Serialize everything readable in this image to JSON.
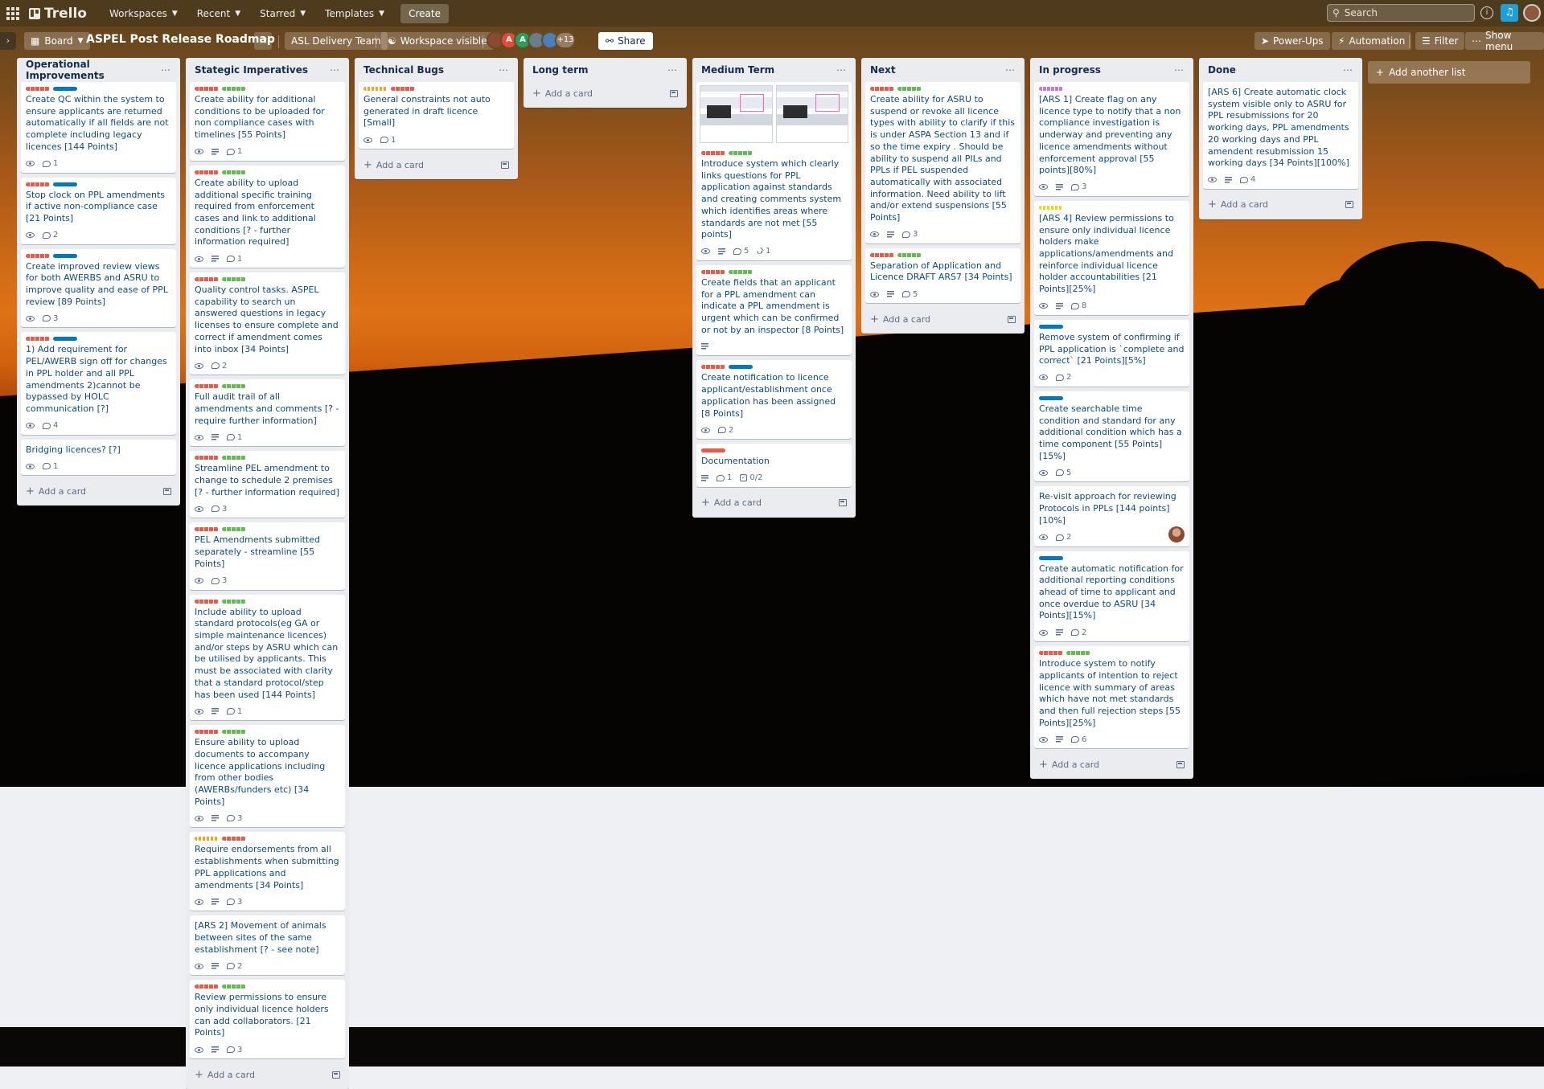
{
  "header": {
    "app_name": "Trello",
    "nav": [
      "Workspaces",
      "Recent",
      "Starred",
      "Templates"
    ],
    "create": "Create",
    "search_placeholder": "Search"
  },
  "boardbar": {
    "view": "Board",
    "title": "ASPEL Post Release Roadmap",
    "team": "ASL Delivery Team",
    "visibility": "Workspace visible",
    "avatar_letters": [
      "",
      "A",
      "A",
      "",
      ""
    ],
    "members_more": "+13",
    "share": "Share",
    "powerups": "Power-Ups",
    "automation": "Automation",
    "filter": "Filter",
    "show_menu": "Show menu"
  },
  "add_card_label": "Add a card",
  "add_list_label": "Add another list",
  "lists": [
    {
      "title": "Operational Improvements",
      "cards": [
        {
          "labels": [
            "red",
            "blue"
          ],
          "text": "Create QC within the system to ensure applicants are returned automatically if all fields are not complete including legacy licences [144 Points]",
          "eye": true,
          "desc": false,
          "comments": "1"
        },
        {
          "labels": [
            "red",
            "blue"
          ],
          "text": "Stop clock on PPL amendments if active non-compliance case [21 Points]",
          "eye": true,
          "desc": false,
          "comments": "2"
        },
        {
          "labels": [
            "red",
            "blue"
          ],
          "text": "Create improved review views for both AWERBS and ASRU to improve quality and ease of PPL review [89 Points]",
          "eye": true,
          "desc": false,
          "comments": "3"
        },
        {
          "labels": [
            "red",
            "blue"
          ],
          "text": "1) Add requirement for PEL/AWERB sign off for changes in PPL holder and all PPL amendments 2)cannot be bypassed by HOLC communication [?]",
          "eye": true,
          "desc": false,
          "comments": "4"
        },
        {
          "labels": [],
          "text": "Bridging licences? [?]",
          "eye": true,
          "desc": false,
          "comments": "1"
        }
      ]
    },
    {
      "title": "Stategic Imperatives",
      "cards": [
        {
          "labels": [
            "red",
            "green"
          ],
          "text": "Create ability for additional conditions to be uploaded for non compliance cases with timelines [55 Points]",
          "eye": true,
          "desc": true,
          "comments": "1"
        },
        {
          "labels": [
            "red",
            "green"
          ],
          "text": "Create ability to upload additional specific training required from enforcement cases and link to additional conditions [? - further information required]",
          "eye": true,
          "desc": true,
          "comments": "1"
        },
        {
          "labels": [
            "red",
            "green"
          ],
          "text": "Quality control tasks. ASPEL capability to search un answered questions in legacy licenses to ensure complete and correct if amendment comes into inbox [34 Points]",
          "eye": true,
          "desc": false,
          "comments": "2"
        },
        {
          "labels": [
            "red",
            "green"
          ],
          "text": "Full audit trail of all amendments and comments [? - require further information]",
          "eye": true,
          "desc": true,
          "comments": "1"
        },
        {
          "labels": [
            "red",
            "green"
          ],
          "text": "Streamline PEL amendment to change to schedule 2 premises [? - further information required]",
          "eye": true,
          "desc": false,
          "comments": "3"
        },
        {
          "labels": [
            "red",
            "green"
          ],
          "text": "PEL Amendments submitted separately - streamline [55 Points]",
          "eye": true,
          "desc": false,
          "comments": "3"
        },
        {
          "labels": [
            "red",
            "green"
          ],
          "text": "Include ability to upload standard protocols(eg GA or simple maintenance licences) and/or steps by ASRU which can be utilised by applicants. This must be associated with clarity that a standard protocol/step has been used [144 Points]",
          "eye": true,
          "desc": true,
          "comments": "1"
        },
        {
          "labels": [
            "red",
            "green"
          ],
          "text": "Ensure ability to upload documents to accompany licence applications including from other bodies (AWERBs/funders etc) [34 Points]",
          "eye": true,
          "desc": true,
          "comments": "3"
        },
        {
          "labels": [
            "orange",
            "red"
          ],
          "text": "Require endorsements from all establishments when submitting PPL applications and amendments [34 Points]",
          "eye": true,
          "desc": true,
          "comments": "3"
        },
        {
          "labels": [],
          "text": "[ARS 2] Movement of animals between sites of the same establishment [? - see note]",
          "eye": true,
          "desc": true,
          "comments": "2"
        },
        {
          "labels": [
            "red",
            "green"
          ],
          "text": "Review permissions to ensure only individual licence holders can add collaborators. [21 Points]",
          "eye": true,
          "desc": true,
          "comments": "3"
        }
      ]
    },
    {
      "title": "Technical Bugs",
      "cards": [
        {
          "labels": [
            "orange",
            "red"
          ],
          "text": "General constraints not auto generated in draft licence [Small]",
          "eye": true,
          "desc": false,
          "comments": "1"
        }
      ]
    },
    {
      "title": "Long term",
      "cards": []
    },
    {
      "title": "Medium Term",
      "cards": [
        {
          "cover": true,
          "labels": [
            "red",
            "green"
          ],
          "text": "Introduce system which clearly links questions for PPL application against standards and creating comments system which identifies areas where standards are not met [55 points]",
          "eye": true,
          "desc": true,
          "comments": "5",
          "attachments": "1"
        },
        {
          "labels": [
            "red",
            "green"
          ],
          "text": "Create fields that an applicant for a PPL amendment can indicate a PPL amendment is urgent which can be confirmed or not by an inspector [8 Points]",
          "eye": false,
          "desc": true,
          "comments": ""
        },
        {
          "labels": [
            "red",
            "blue"
          ],
          "text": "Create notification to licence applicant/establishment once application has been assigned [8 Points]",
          "eye": true,
          "desc": false,
          "comments": "2"
        },
        {
          "labels": [
            "red2"
          ],
          "text": "Documentation",
          "eye": false,
          "desc": true,
          "comments": "1",
          "checklist": "0/2"
        }
      ]
    },
    {
      "title": "Next",
      "cards": [
        {
          "labels": [
            "red",
            "green"
          ],
          "text": "Create ability for ASRU to suspend or revoke all licence types with ability to clarify if this is under ASPA Section 13 and if so the time expiry . Should be ability to suspend all PILs and PPLs if PEL suspended automatically with associated information. Need ability to lift and/or extend suspensions [55 Points]",
          "eye": true,
          "desc": true,
          "comments": "3"
        },
        {
          "labels": [
            "red",
            "green"
          ],
          "text": "Separation of Application and Licence DRAFT ARS7 [34 Points]",
          "eye": true,
          "desc": true,
          "comments": "5"
        }
      ]
    },
    {
      "title": "In progress",
      "cards": [
        {
          "labels": [
            "purple"
          ],
          "text": "[ARS 1] Create flag on any licence type to notify that a non compliance investigation is underway and preventing any licence amendments without enforcement approval [55 points][80%]",
          "eye": true,
          "desc": true,
          "comments": "3"
        },
        {
          "labels": [
            "yellow"
          ],
          "text": "[ARS 4] Review permissions to ensure only individual licence holders make applications/amendments and reinforce individual licence holder accountabilities [21 Points][25%]",
          "eye": true,
          "desc": true,
          "comments": "8"
        },
        {
          "labels": [
            "blue"
          ],
          "text": "Remove system of confirming if PPL application is `complete and correct` [21 Points][5%]",
          "eye": true,
          "desc": false,
          "comments": "2"
        },
        {
          "labels": [
            "blue"
          ],
          "text": "Create searchable time condition and standard for any additional condition which has a time component [55 Points][15%]",
          "eye": true,
          "desc": false,
          "comments": "5"
        },
        {
          "labels": [],
          "text": "Re-visit approach for reviewing Protocols in PPLs [144 points][10%]",
          "eye": true,
          "desc": false,
          "comments": "2",
          "avatar": true
        },
        {
          "labels": [
            "blue"
          ],
          "text": "Create automatic notification for additional reporting conditions ahead of time to applicant and once overdue to ASRU [34 Points][15%]",
          "eye": true,
          "desc": true,
          "comments": "2"
        },
        {
          "labels": [
            "red",
            "green"
          ],
          "text": "Introduce system to notify applicants of intention to reject licence with summary of areas which have not met standards and then full rejection steps [55 Points][25%]",
          "eye": true,
          "desc": true,
          "comments": "6"
        }
      ]
    },
    {
      "title": "Done",
      "cards": [
        {
          "labels": [],
          "text": "[ARS 6] Create automatic clock system visible only to ASRU for PPL resubmissions for 20 working days, PPL amendments 20 working days and PPL amendent resubmission 15 working days [34 Points][100%]",
          "eye": true,
          "desc": true,
          "comments": "4"
        }
      ]
    }
  ]
}
